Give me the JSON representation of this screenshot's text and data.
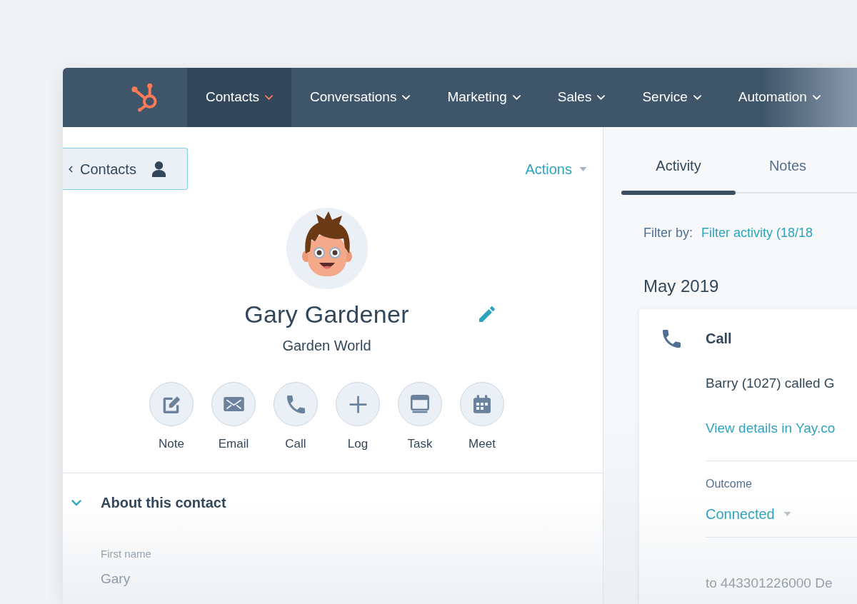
{
  "nav": {
    "items": [
      {
        "label": "Contacts",
        "selected": true
      },
      {
        "label": "Conversations",
        "selected": false
      },
      {
        "label": "Marketing",
        "selected": false
      },
      {
        "label": "Sales",
        "selected": false
      },
      {
        "label": "Service",
        "selected": false
      },
      {
        "label": "Automation",
        "selected": false
      }
    ]
  },
  "back_button": {
    "label": "Contacts"
  },
  "actions_menu": {
    "label": "Actions"
  },
  "contact": {
    "name": "Gary Gardener",
    "company": "Garden World"
  },
  "quick_actions": [
    {
      "kind": "note",
      "label": "Note"
    },
    {
      "kind": "email",
      "label": "Email"
    },
    {
      "kind": "call",
      "label": "Call"
    },
    {
      "kind": "log",
      "label": "Log"
    },
    {
      "kind": "task",
      "label": "Task"
    },
    {
      "kind": "meet",
      "label": "Meet"
    }
  ],
  "about": {
    "title": "About this contact",
    "expanded": true,
    "fields": [
      {
        "label": "First name",
        "value": "Gary"
      }
    ]
  },
  "activity_tabs": [
    {
      "label": "Activity",
      "selected": true
    },
    {
      "label": "Notes",
      "selected": false
    }
  ],
  "filter": {
    "label": "Filter by:",
    "value": "Filter activity (18/18"
  },
  "month": "May 2019",
  "activity_card": {
    "kind": "call",
    "title": "Call",
    "description": "Barry (1027) called G",
    "link": "View details in Yay.co",
    "outcome": {
      "label": "Outcome",
      "value": "Connected"
    },
    "footer": "to 443301226000 De"
  }
}
